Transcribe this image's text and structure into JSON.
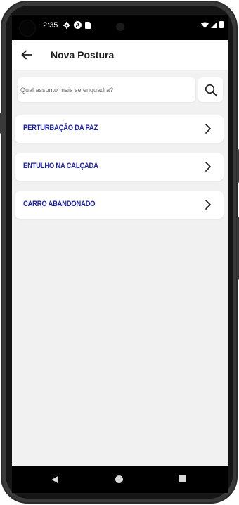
{
  "status_bar": {
    "time": "2:35",
    "icons": [
      "gear-icon",
      "a-icon",
      "sd-card-icon",
      "wifi-icon",
      "signal-icon",
      "battery-icon"
    ]
  },
  "app_bar": {
    "back_icon": "arrow-left-icon",
    "title": "Nova Postura"
  },
  "search": {
    "placeholder": "Qual assunto mais se enquadra?",
    "value": "",
    "icon": "search-icon"
  },
  "items": [
    {
      "label": "PERTURBAÇÃO DA PAZ",
      "icon": "chevron-right-icon"
    },
    {
      "label": "ENTULHO NA CALÇADA",
      "icon": "chevron-right-icon"
    },
    {
      "label": "CARRO ABANDONADO",
      "icon": "chevron-right-icon"
    }
  ],
  "nav_bar": {
    "icons": [
      "nav-back-icon",
      "nav-home-icon",
      "nav-recents-icon"
    ]
  },
  "colors": {
    "accent_text": "#1a1fb0",
    "background": "#f1f1f1",
    "card": "#ffffff",
    "title": "#1e1e1e"
  }
}
